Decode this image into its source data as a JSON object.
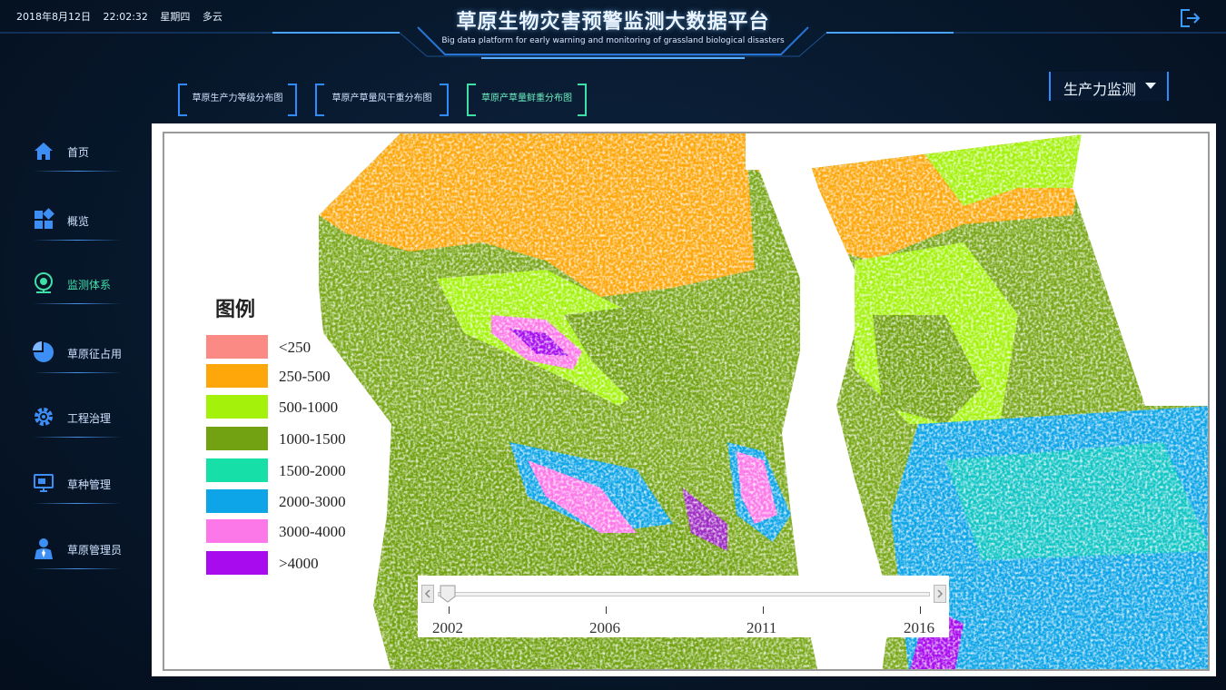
{
  "header": {
    "date": "2018年8月12日",
    "time": "22:02:32",
    "weekday": "星期四",
    "weather": "多云",
    "title": "草原生物灾害预警监测大数据平台",
    "subtitle": "Big data platform for early warning and monitoring of grassland biological disasters"
  },
  "sidebar": {
    "items": [
      {
        "label": "首页",
        "icon": "home-icon"
      },
      {
        "label": "概览",
        "icon": "dashboard-grid-icon"
      },
      {
        "label": "监测体系",
        "icon": "monitor-globe-icon",
        "active": true
      },
      {
        "label": "草原征占用",
        "icon": "pie-chart-icon"
      },
      {
        "label": "工程治理",
        "icon": "gear-icon"
      },
      {
        "label": "草种管理",
        "icon": "screen-icon"
      },
      {
        "label": "草原管理员",
        "icon": "person-icon"
      }
    ]
  },
  "tabs": [
    {
      "label": "草原生产力等级分布图"
    },
    {
      "label": "草原产草量风干重分布图"
    },
    {
      "label": "草原产草量鲜重分布图",
      "active": true
    }
  ],
  "dropdown": {
    "value": "生产力监测"
  },
  "legend": {
    "title": "图例",
    "items": [
      {
        "label": "<250",
        "color": "#fb8a84"
      },
      {
        "label": "250-500",
        "color": "#fda70a"
      },
      {
        "label": "500-1000",
        "color": "#a4f20c"
      },
      {
        "label": "1000-1500",
        "color": "#72a212"
      },
      {
        "label": "1500-2000",
        "color": "#16e0a8"
      },
      {
        "label": "2000-3000",
        "color": "#0ea5e8"
      },
      {
        "label": "3000-4000",
        "color": "#fc78e8"
      },
      {
        "label": ">4000",
        "color": "#a80cee"
      }
    ]
  },
  "timeline": {
    "years": [
      "2002",
      "2006",
      "2011",
      "2016"
    ],
    "selected_year": "2002"
  }
}
